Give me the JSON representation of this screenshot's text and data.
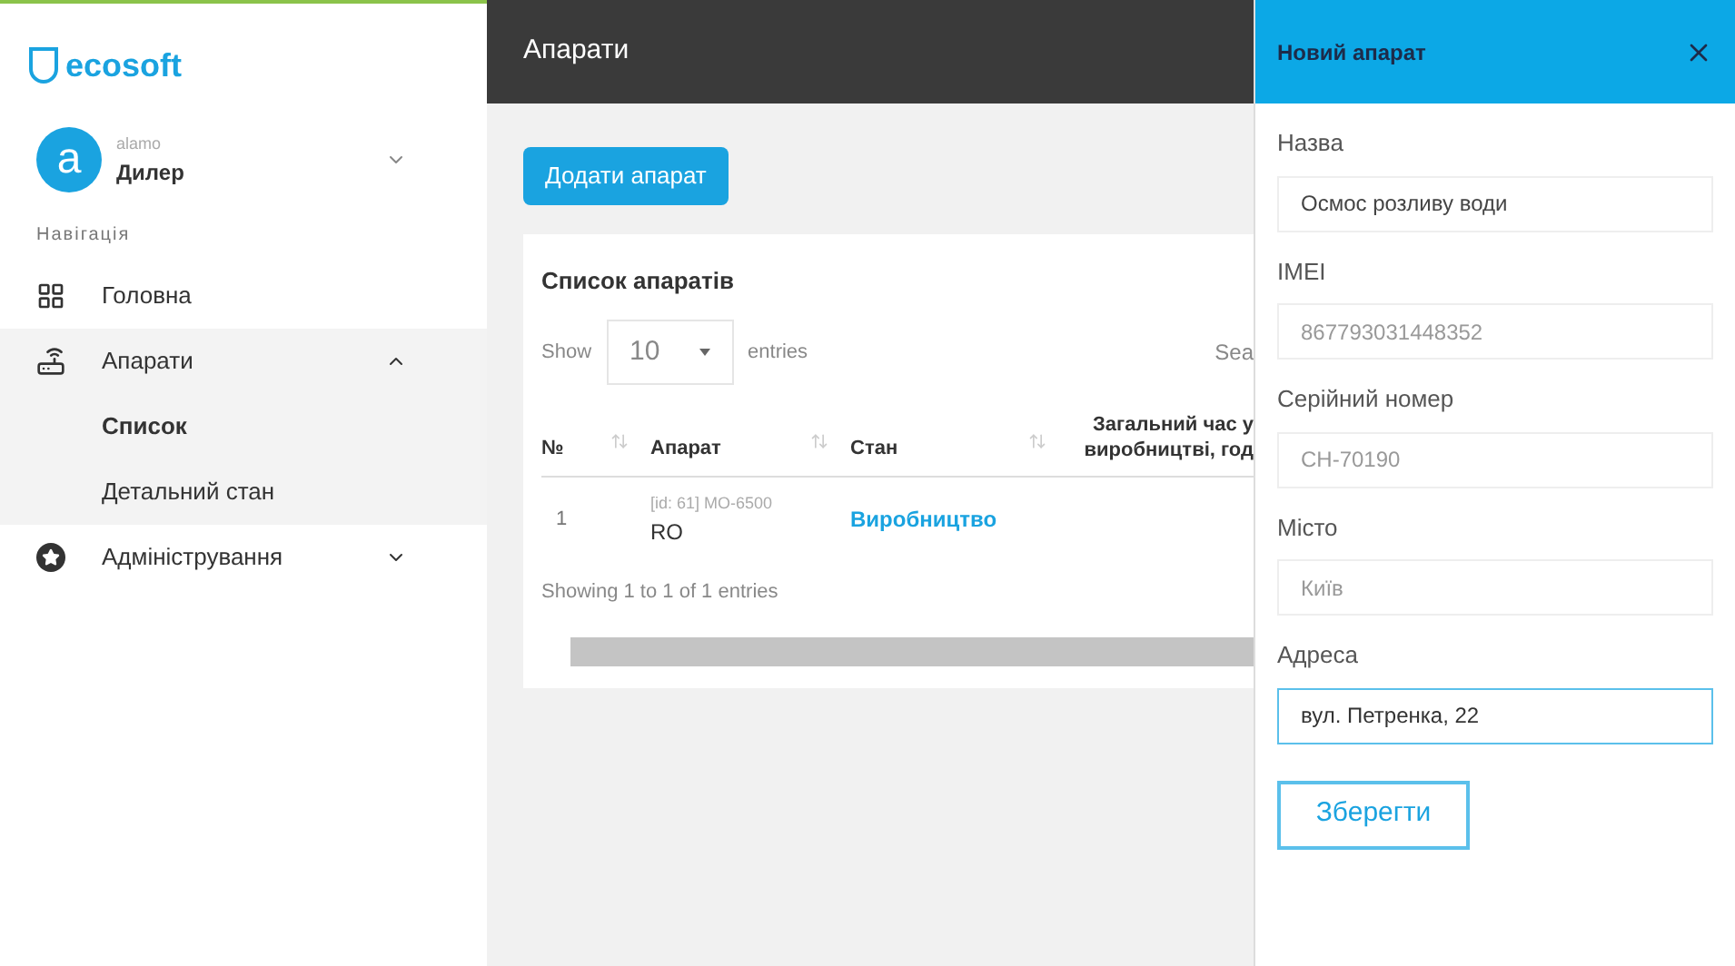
{
  "sidebar": {
    "logo": "ecosoft",
    "user": {
      "avatar": "a",
      "name": "alamo",
      "role": "Дилер"
    },
    "nav_heading": "Навігація",
    "items": [
      {
        "label": "Головна",
        "kind": "dashboard",
        "expanded": false
      },
      {
        "label": "Апарати",
        "kind": "device",
        "expanded": true,
        "children": [
          {
            "label": "Список",
            "selected": true
          },
          {
            "label": "Детальний стан",
            "selected": false
          }
        ]
      },
      {
        "label": "Адміністрування",
        "kind": "star",
        "expanded": false
      }
    ]
  },
  "header": {
    "title": "Апарати"
  },
  "add_button": "Додати апарат",
  "list": {
    "title": "Список апаратів",
    "show_label": "Show",
    "page_size": "10",
    "entries_label": "entries",
    "search_label": "Sea",
    "columns": [
      "№",
      "Апарат",
      "Стан",
      "Загальний час у виробництві, год"
    ],
    "rows": [
      {
        "number": "1",
        "device_id": "[id: 61] MO-6500",
        "device_name": "RO",
        "state": "Виробництво"
      }
    ],
    "footer": "Showing 1 to 1 of 1 entries"
  },
  "panel": {
    "title": "Новий апарат",
    "fields": [
      {
        "label": "Назва",
        "value": "Осмос розливу води",
        "focused": false
      },
      {
        "label": "IMEI",
        "placeholder": "867793031448352",
        "focused": false
      },
      {
        "label": "Серійний номер",
        "placeholder": "CH-70190",
        "focused": false
      },
      {
        "label": "Місто",
        "placeholder": "Київ",
        "focused": false
      },
      {
        "label": "Адреса",
        "value": "вул. Петренка, 22",
        "focused": true
      }
    ],
    "save_button": "Зберегти"
  }
}
